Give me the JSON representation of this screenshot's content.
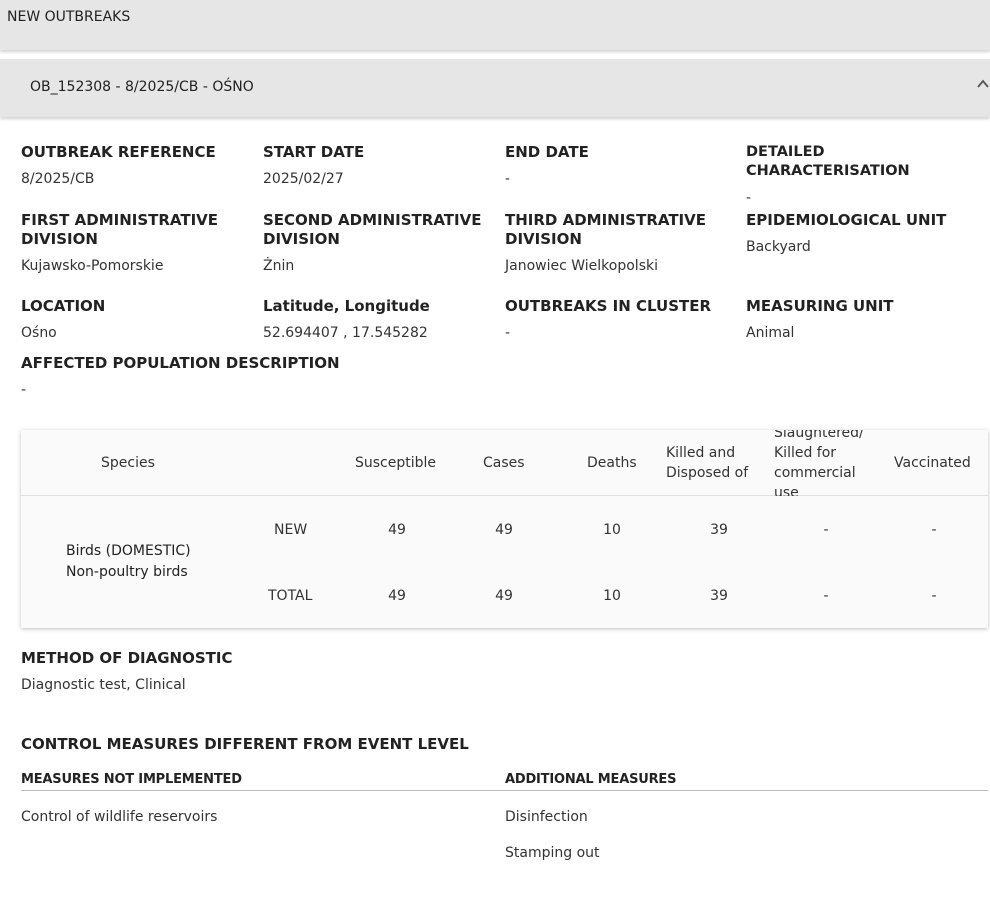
{
  "top_bar": {
    "title": "NEW OUTBREAKS"
  },
  "panel": {
    "title": "OB_152308 - 8/2025/CB - OŚNO",
    "icon": "chevron-up-icon"
  },
  "fields": {
    "outbreak_reference": {
      "label": "OUTBREAK REFERENCE",
      "value": "8/2025/CB"
    },
    "start_date": {
      "label": "START DATE",
      "value": "2025/02/27"
    },
    "end_date": {
      "label": "END DATE",
      "value": "-"
    },
    "detailed_characterisation": {
      "label": "DETAILED CHARACTERISATION",
      "value": "-"
    },
    "first_admin_division": {
      "label": "FIRST ADMINISTRATIVE DIVISION",
      "value": "Kujawsko-Pomorskie"
    },
    "second_admin_division": {
      "label": "SECOND ADMINISTRATIVE DIVISION",
      "value": "Żnin"
    },
    "third_admin_division": {
      "label": "THIRD ADMINISTRATIVE DIVISION",
      "value": "Janowiec Wielkopolski"
    },
    "epidemiological_unit": {
      "label": "EPIDEMIOLOGICAL UNIT",
      "value": "Backyard"
    },
    "location": {
      "label": "LOCATION",
      "value": "Ośno"
    },
    "lat_long": {
      "label": "Latitude, Longitude",
      "value": "52.694407 , 17.545282"
    },
    "outbreaks_in_cluster": {
      "label": "OUTBREAKS IN CLUSTER",
      "value": "-"
    },
    "measuring_unit": {
      "label": "MEASURING UNIT",
      "value": "Animal"
    },
    "affected_population": {
      "label": "AFFECTED POPULATION DESCRIPTION",
      "value": "-"
    }
  },
  "table": {
    "headers": {
      "species": "Species",
      "susceptible": "Susceptible",
      "cases": "Cases",
      "deaths": "Deaths",
      "killed": "Killed and Disposed of",
      "slaughtered": "Slaughtered/ Killed for commercial use",
      "vaccinated": "Vaccinated"
    },
    "species_line1": "Birds (DOMESTIC)",
    "species_line2": "Non-poultry birds",
    "rows": [
      {
        "label": "NEW",
        "susceptible": "49",
        "cases": "49",
        "deaths": "10",
        "killed": "39",
        "slaughtered": "-",
        "vaccinated": "-"
      },
      {
        "label": "TOTAL",
        "susceptible": "49",
        "cases": "49",
        "deaths": "10",
        "killed": "39",
        "slaughtered": "-",
        "vaccinated": "-"
      }
    ]
  },
  "diagnostic": {
    "label": "METHOD OF DIAGNOSTIC",
    "value": "Diagnostic test, Clinical"
  },
  "control_measures": {
    "title": "CONTROL MEASURES DIFFERENT FROM EVENT LEVEL",
    "not_implemented_label": "MEASURES NOT IMPLEMENTED",
    "additional_label": "ADDITIONAL MEASURES",
    "not_implemented": [
      "Control of wildlife reservoirs"
    ],
    "additional": [
      "Disinfection",
      "Stamping out"
    ]
  }
}
